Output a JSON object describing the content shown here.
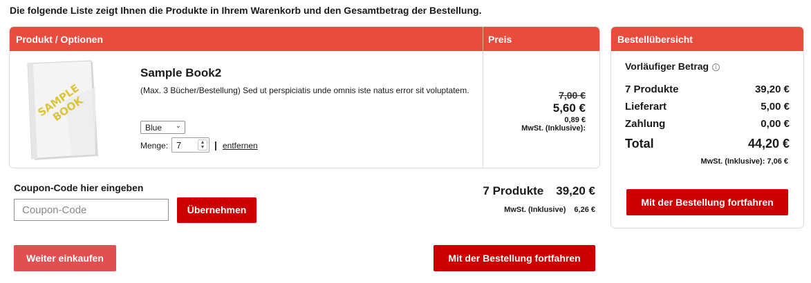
{
  "intro_text": "Die folgende Liste zeigt Ihnen die Produkte in Ihrem Warenkorb und den Gesamtbetrag der Bestellung.",
  "cart": {
    "header_product": "Produkt / Optionen",
    "header_price": "Preis",
    "item": {
      "image_text": [
        "SAMPLE",
        "BOOK"
      ],
      "name": "Sample Book2",
      "description": "(Max. 3 Bücher/Bestellung) Sed ut perspiciatis unde omnis iste natus error sit voluptatem.",
      "variant_selected": "Blue",
      "quantity_label": "Menge:",
      "quantity": "7",
      "remove_label": "entfernen",
      "old_price": "7,00 €",
      "price": "5,60 €",
      "tax_amount": "0,89 €",
      "tax_label": "MwSt. (Inklusive):"
    }
  },
  "coupon": {
    "title": "Coupon-Code hier eingeben",
    "placeholder": "Coupon-Code",
    "apply_label": "Übernehmen"
  },
  "cart_total": {
    "label": "7 Produkte",
    "value": "39,20 €",
    "tax_label": "MwSt. (Inklusive)",
    "tax_value": "6,26 €"
  },
  "actions": {
    "continue_shopping": "Weiter einkaufen",
    "checkout": "Mit der Bestellung fortfahren"
  },
  "summary": {
    "title": "Bestellübersicht",
    "subtotal_title": "Vorläufiger Betrag",
    "info_icon": "i",
    "rows": [
      {
        "label": "7 Produkte",
        "value": "39,20 €"
      },
      {
        "label": "Lieferart",
        "value": "5,00 €"
      },
      {
        "label": "Zahlung",
        "value": "0,00 €"
      },
      {
        "label": "Total",
        "value": "44,20 €"
      }
    ],
    "tax": "MwSt. (Inklusive): 7,06 €",
    "checkout": "Mit der Bestellung fortfahren"
  },
  "colors": {
    "header": "#e84c3d",
    "button": "#cc0000",
    "button_light": "#e05050"
  }
}
